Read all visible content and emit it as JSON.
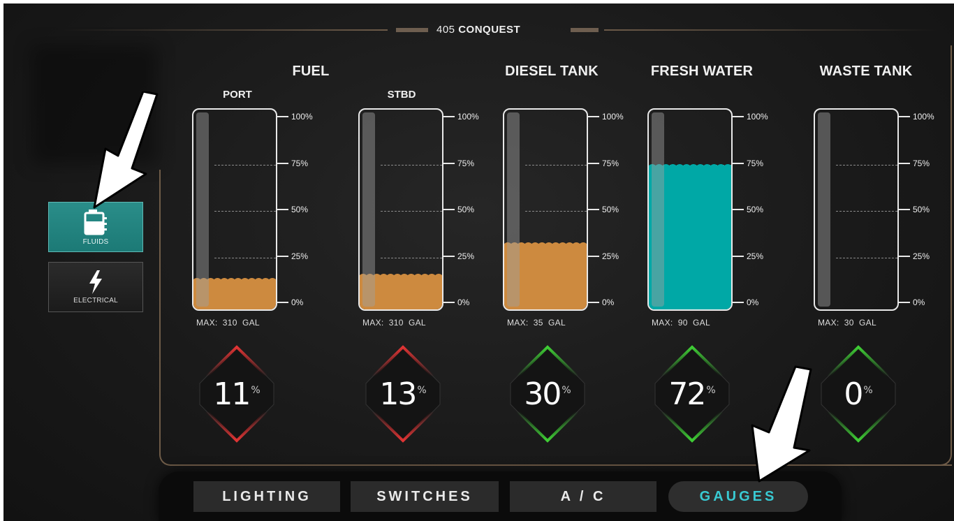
{
  "header": {
    "title_prefix": "405",
    "title_bold": "CONQUEST"
  },
  "side_nav": [
    {
      "label": "FLUIDS",
      "icon": "fluid-tank-icon",
      "active": true
    },
    {
      "label": "ELECTRICAL",
      "icon": "lightning-bolt-icon",
      "active": false
    }
  ],
  "groups": {
    "fuel": "FUEL",
    "diesel": "DIESEL TANK",
    "fresh": "FRESH WATER",
    "waste": "WASTE TANK",
    "port": "PORT",
    "stbd": "STBD"
  },
  "scale_labels": [
    "100%",
    "75%",
    "50%",
    "25%",
    "0%"
  ],
  "tanks": [
    {
      "id": "port",
      "max_label": "MAX:",
      "max_value": "310",
      "unit": "GAL",
      "level": 0.11,
      "readout": "11",
      "pct": "%",
      "fill_color": "#cd8a3f",
      "status_color": "#e23434"
    },
    {
      "id": "stbd",
      "max_label": "MAX:",
      "max_value": "310",
      "unit": "GAL",
      "level": 0.13,
      "readout": "13",
      "pct": "%",
      "fill_color": "#cd8a3f",
      "status_color": "#e23434"
    },
    {
      "id": "diesel",
      "max_label": "MAX:",
      "max_value": "35",
      "unit": "GAL",
      "level": 0.3,
      "readout": "30",
      "pct": "%",
      "fill_color": "#cd8a3f",
      "status_color": "#3fcf35"
    },
    {
      "id": "fresh",
      "max_label": "MAX:",
      "max_value": "90",
      "unit": "GAL",
      "level": 0.72,
      "readout": "72",
      "pct": "%",
      "fill_color": "#00a8a6",
      "status_color": "#3fcf35"
    },
    {
      "id": "waste",
      "max_label": "MAX:",
      "max_value": "30",
      "unit": "GAL",
      "level": 0.0,
      "readout": "0",
      "pct": "%",
      "fill_color": "#cd8a3f",
      "status_color": "#3fcf35"
    }
  ],
  "tabs": [
    {
      "label": "LIGHTING",
      "active": false
    },
    {
      "label": "SWITCHES",
      "active": false
    },
    {
      "label": "A / C",
      "active": false
    },
    {
      "label": "GAUGES",
      "active": true
    }
  ],
  "colors": {
    "accent": "#39c9d2",
    "frame": "#6f5c48",
    "fluids_button": "#1f807c"
  }
}
